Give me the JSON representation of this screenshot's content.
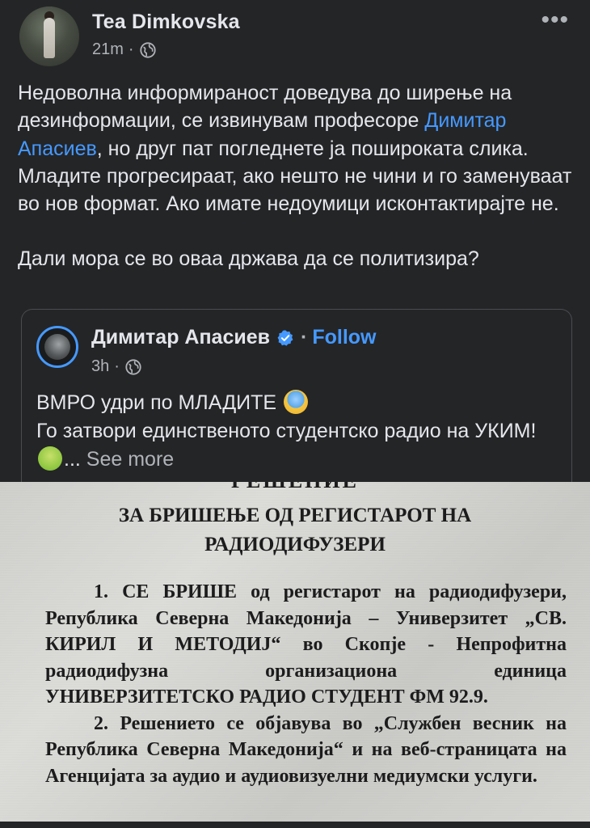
{
  "post": {
    "author": "Tea Dimkovska",
    "time": "21m",
    "separator": "·",
    "more_label": "•••",
    "text_part1": "Недоволна информираност доведува до ширење на дезинформации, се извинувам професоре ",
    "mention": "Димитар Апасиев",
    "text_part2": ", но друг пат погледнете ја поширoката слика. Младите прогресираат, ако нешто не чини и го заменуваат во нов формат. Ако имате недоумици исконтактирајте не.",
    "question": "Дали мора се во оваа држава да се политизира?"
  },
  "shared": {
    "author": "Димитар Апасиев",
    "separator": "·",
    "follow_label": "Follow",
    "time": "3h",
    "line1": "ВМРО удри по МЛАДИТЕ",
    "line2_part1": "Го затвори единственото студентско радио на УКИМ!",
    "ellipsis": "...",
    "see_more_label": "See more"
  },
  "document": {
    "heading_cut": "РЕШЕНИЕ",
    "title_line1": "ЗА БРИШЕЊЕ ОД РЕГИСТАРОТ НА",
    "title_line2": "РАДИОДИФУЗЕРИ",
    "para1": "1. СЕ БРИШЕ од регистарот на радиодифузери, Република Северна Македонија – Универзитет „СВ. КИРИЛ И МЕТОДИЈ“ во Скопје - Непрофитна радиодифузна организациона единица УНИВЕРЗИТЕТСКО РАДИО СТУДЕНТ ФМ 92.9.",
    "para2": "2. Решението се објавува во „Службен весник на Република Северна Македонија“ и на веб-страницата на Агенцијата за аудио и аудиовизуелни медиумски услуги."
  },
  "colors": {
    "background": "#242527",
    "text": "#e4e6eb",
    "secondary": "#b0b3b8",
    "link": "#4599ff"
  }
}
